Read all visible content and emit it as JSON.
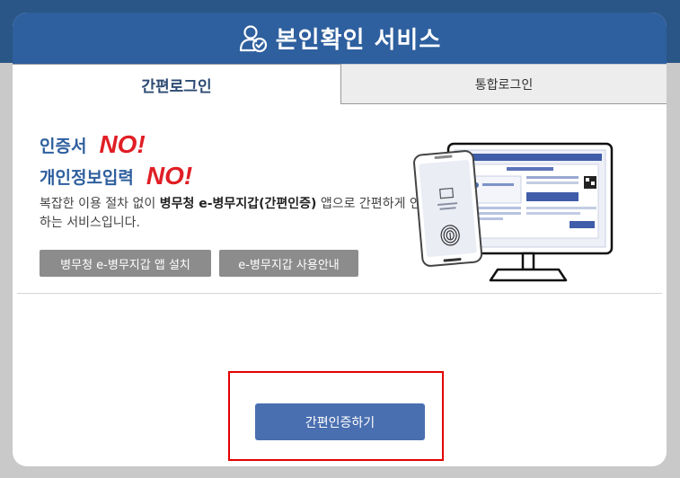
{
  "header": {
    "title": "본인확인 서비스",
    "icon": "user-check-icon",
    "bg_color": "#2e5f9e"
  },
  "tabs": [
    {
      "label": "간편로그인",
      "active": true
    },
    {
      "label": "통합로그인",
      "active": false
    }
  ],
  "promo": {
    "line1_label": "인증서",
    "line1_no": "NO!",
    "line2_label": "개인정보입력",
    "line2_no": "NO!",
    "desc_part1": "복잡한 이용 절차 없이 ",
    "desc_bold": "병무청 e-병무지갑(간편인증)",
    "desc_part2": " 앱으로 간편하게 인증하는 서비스입니다.",
    "accent_color": "#e01e25"
  },
  "buttons": {
    "install_app": "병무청 e-병무지갑 앱 설치",
    "usage_guide": "e-병무지갑 사용안내",
    "simple_auth": "간편인증하기"
  },
  "illustration": {
    "phone_icon": "fingerprint-icon",
    "monitor_screen": "monitor-screen"
  }
}
